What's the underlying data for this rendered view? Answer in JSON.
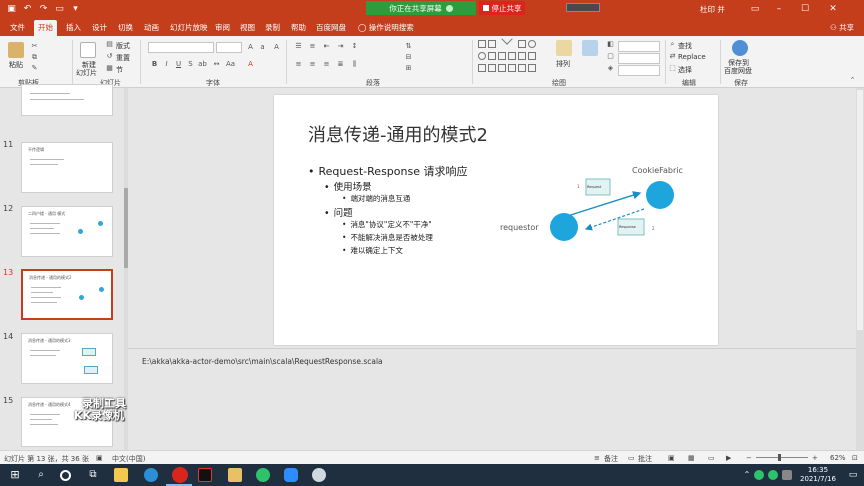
{
  "titlebar": {
    "share_status": "你正在共享屏幕",
    "stop_share": "停止共享",
    "user": "杜印 并",
    "min": "–",
    "max": "☐",
    "close": "✕"
  },
  "tabs": [
    "文件",
    "开始",
    "插入",
    "设计",
    "切换",
    "动画",
    "幻灯片放映",
    "审阅",
    "视图",
    "录制",
    "帮助",
    "百度网盘",
    "操作说明搜索"
  ],
  "share_label": "共享",
  "ribbon": {
    "paste": "粘贴",
    "new_slide_line1": "新建",
    "new_slide_line2": "幻灯片",
    "layout": "版式",
    "reset": "重置",
    "section": "节",
    "arrange": "排列",
    "find": "查找",
    "replace": "Replace",
    "select": "选择",
    "save_to_pan_line1": "保存到",
    "save_to_pan_line2": "百度网盘",
    "groups": {
      "clipboard": "剪贴板",
      "slides": "幻灯片",
      "font": "字体",
      "paragraph": "段落",
      "drawing": "绘图",
      "editing": "编辑",
      "save": "保存"
    }
  },
  "thumbnails": [
    {
      "num": "11",
      "title": "不传逻辑"
    },
    {
      "num": "12",
      "title": "二四户楼 - 通用 模式"
    },
    {
      "num": "13",
      "title": "消息传递 - 通用的模式2"
    },
    {
      "num": "14",
      "title": "消息传递 - 通用的模式3"
    },
    {
      "num": "15",
      "title": "消息传递 - 通用的模式4"
    }
  ],
  "slide": {
    "title": "消息传递-通用的模式2",
    "bullets": [
      {
        "level": 1,
        "text": "Request-Response 请求响应"
      },
      {
        "level": 2,
        "text": "使用场景"
      },
      {
        "level": 3,
        "text": "端对端的消息互通"
      },
      {
        "level": 2,
        "text": "问题"
      },
      {
        "level": 3,
        "text": "消息\"协议\"定义不\"干净\""
      },
      {
        "level": 3,
        "text": "不能解决消息是否被处理"
      },
      {
        "level": 3,
        "text": "难以确定上下文"
      }
    ],
    "diagram": {
      "node_a": "requestor",
      "node_b": "CookieFabric",
      "msg_request": "Request",
      "msg_response": "Response",
      "num_1": "1",
      "num_2": "2",
      "node_color": "#1ea6dc",
      "arrow_color": "#1a8ec4"
    }
  },
  "notes": "E:\\akka\\akka-actor-demo\\src\\main\\scala\\RequestResponse.scala",
  "watermark": {
    "line1": "录制工具",
    "line2": "KK录像机"
  },
  "status": {
    "slide_count": "幻灯片 第 13 张，共 36 张",
    "language": "中文(中国)",
    "notes": "备注",
    "comments": "批注",
    "zoom": "62%"
  },
  "clock": {
    "time": "16:35",
    "date": "2021/7/16"
  },
  "colors": {
    "accent": "#c43e1c",
    "share_green": "#2e9c3c",
    "stop_red": "#d8261d"
  }
}
